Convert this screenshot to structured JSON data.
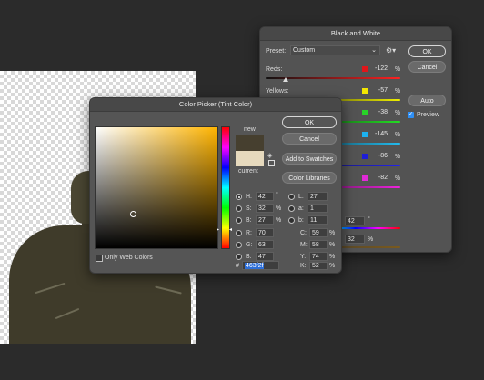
{
  "bw": {
    "title": "Black and White",
    "preset_label": "Preset:",
    "preset_value": "Custom",
    "ok": "OK",
    "cancel": "Cancel",
    "auto": "Auto",
    "preview": "Preview",
    "preview_checked": true,
    "channels": [
      {
        "label": "Reds:",
        "value": "-122",
        "unit": "%",
        "color": "#e0161a"
      },
      {
        "label": "Yellows:",
        "value": "-57",
        "unit": "%",
        "color": "#f3e600"
      },
      {
        "label": "",
        "value": "-38",
        "unit": "%",
        "color": "#28d428"
      },
      {
        "label": "",
        "value": "-145",
        "unit": "%",
        "color": "#1cb2f0"
      },
      {
        "label": "",
        "value": "-86",
        "unit": "%",
        "color": "#1e1ed8"
      },
      {
        "label": "",
        "value": "-82",
        "unit": "%",
        "color": "#e02ad8"
      }
    ],
    "tint_hue_value": "42",
    "tint_hue_unit": "°",
    "tint_sat_value": "32",
    "tint_sat_unit": "%"
  },
  "cp": {
    "title": "Color Picker (Tint Color)",
    "ok": "OK",
    "cancel": "Cancel",
    "add_swatches": "Add to Swatches",
    "color_libraries": "Color Libraries",
    "new_label": "new",
    "current_label": "current",
    "new_color": "#463f2f",
    "current_color": "#e6d9bd",
    "only_web": "Only Web Colors",
    "hsb": [
      {
        "key": "H:",
        "value": "42",
        "unit": "°",
        "selected": true
      },
      {
        "key": "S:",
        "value": "32",
        "unit": "%",
        "selected": false
      },
      {
        "key": "B:",
        "value": "27",
        "unit": "%",
        "selected": false
      }
    ],
    "rgb": [
      {
        "key": "R:",
        "value": "70"
      },
      {
        "key": "G:",
        "value": "63"
      },
      {
        "key": "B:",
        "value": "47"
      }
    ],
    "lab": [
      {
        "key": "L:",
        "value": "27"
      },
      {
        "key": "a:",
        "value": "1"
      },
      {
        "key": "b:",
        "value": "11"
      }
    ],
    "cmyk": [
      {
        "key": "C:",
        "value": "59",
        "unit": "%"
      },
      {
        "key": "M:",
        "value": "58",
        "unit": "%"
      },
      {
        "key": "Y:",
        "value": "74",
        "unit": "%"
      },
      {
        "key": "K:",
        "value": "52",
        "unit": "%"
      }
    ],
    "hex_label": "#",
    "hex_value": "463f2f",
    "hue_color": "#ffb400"
  }
}
